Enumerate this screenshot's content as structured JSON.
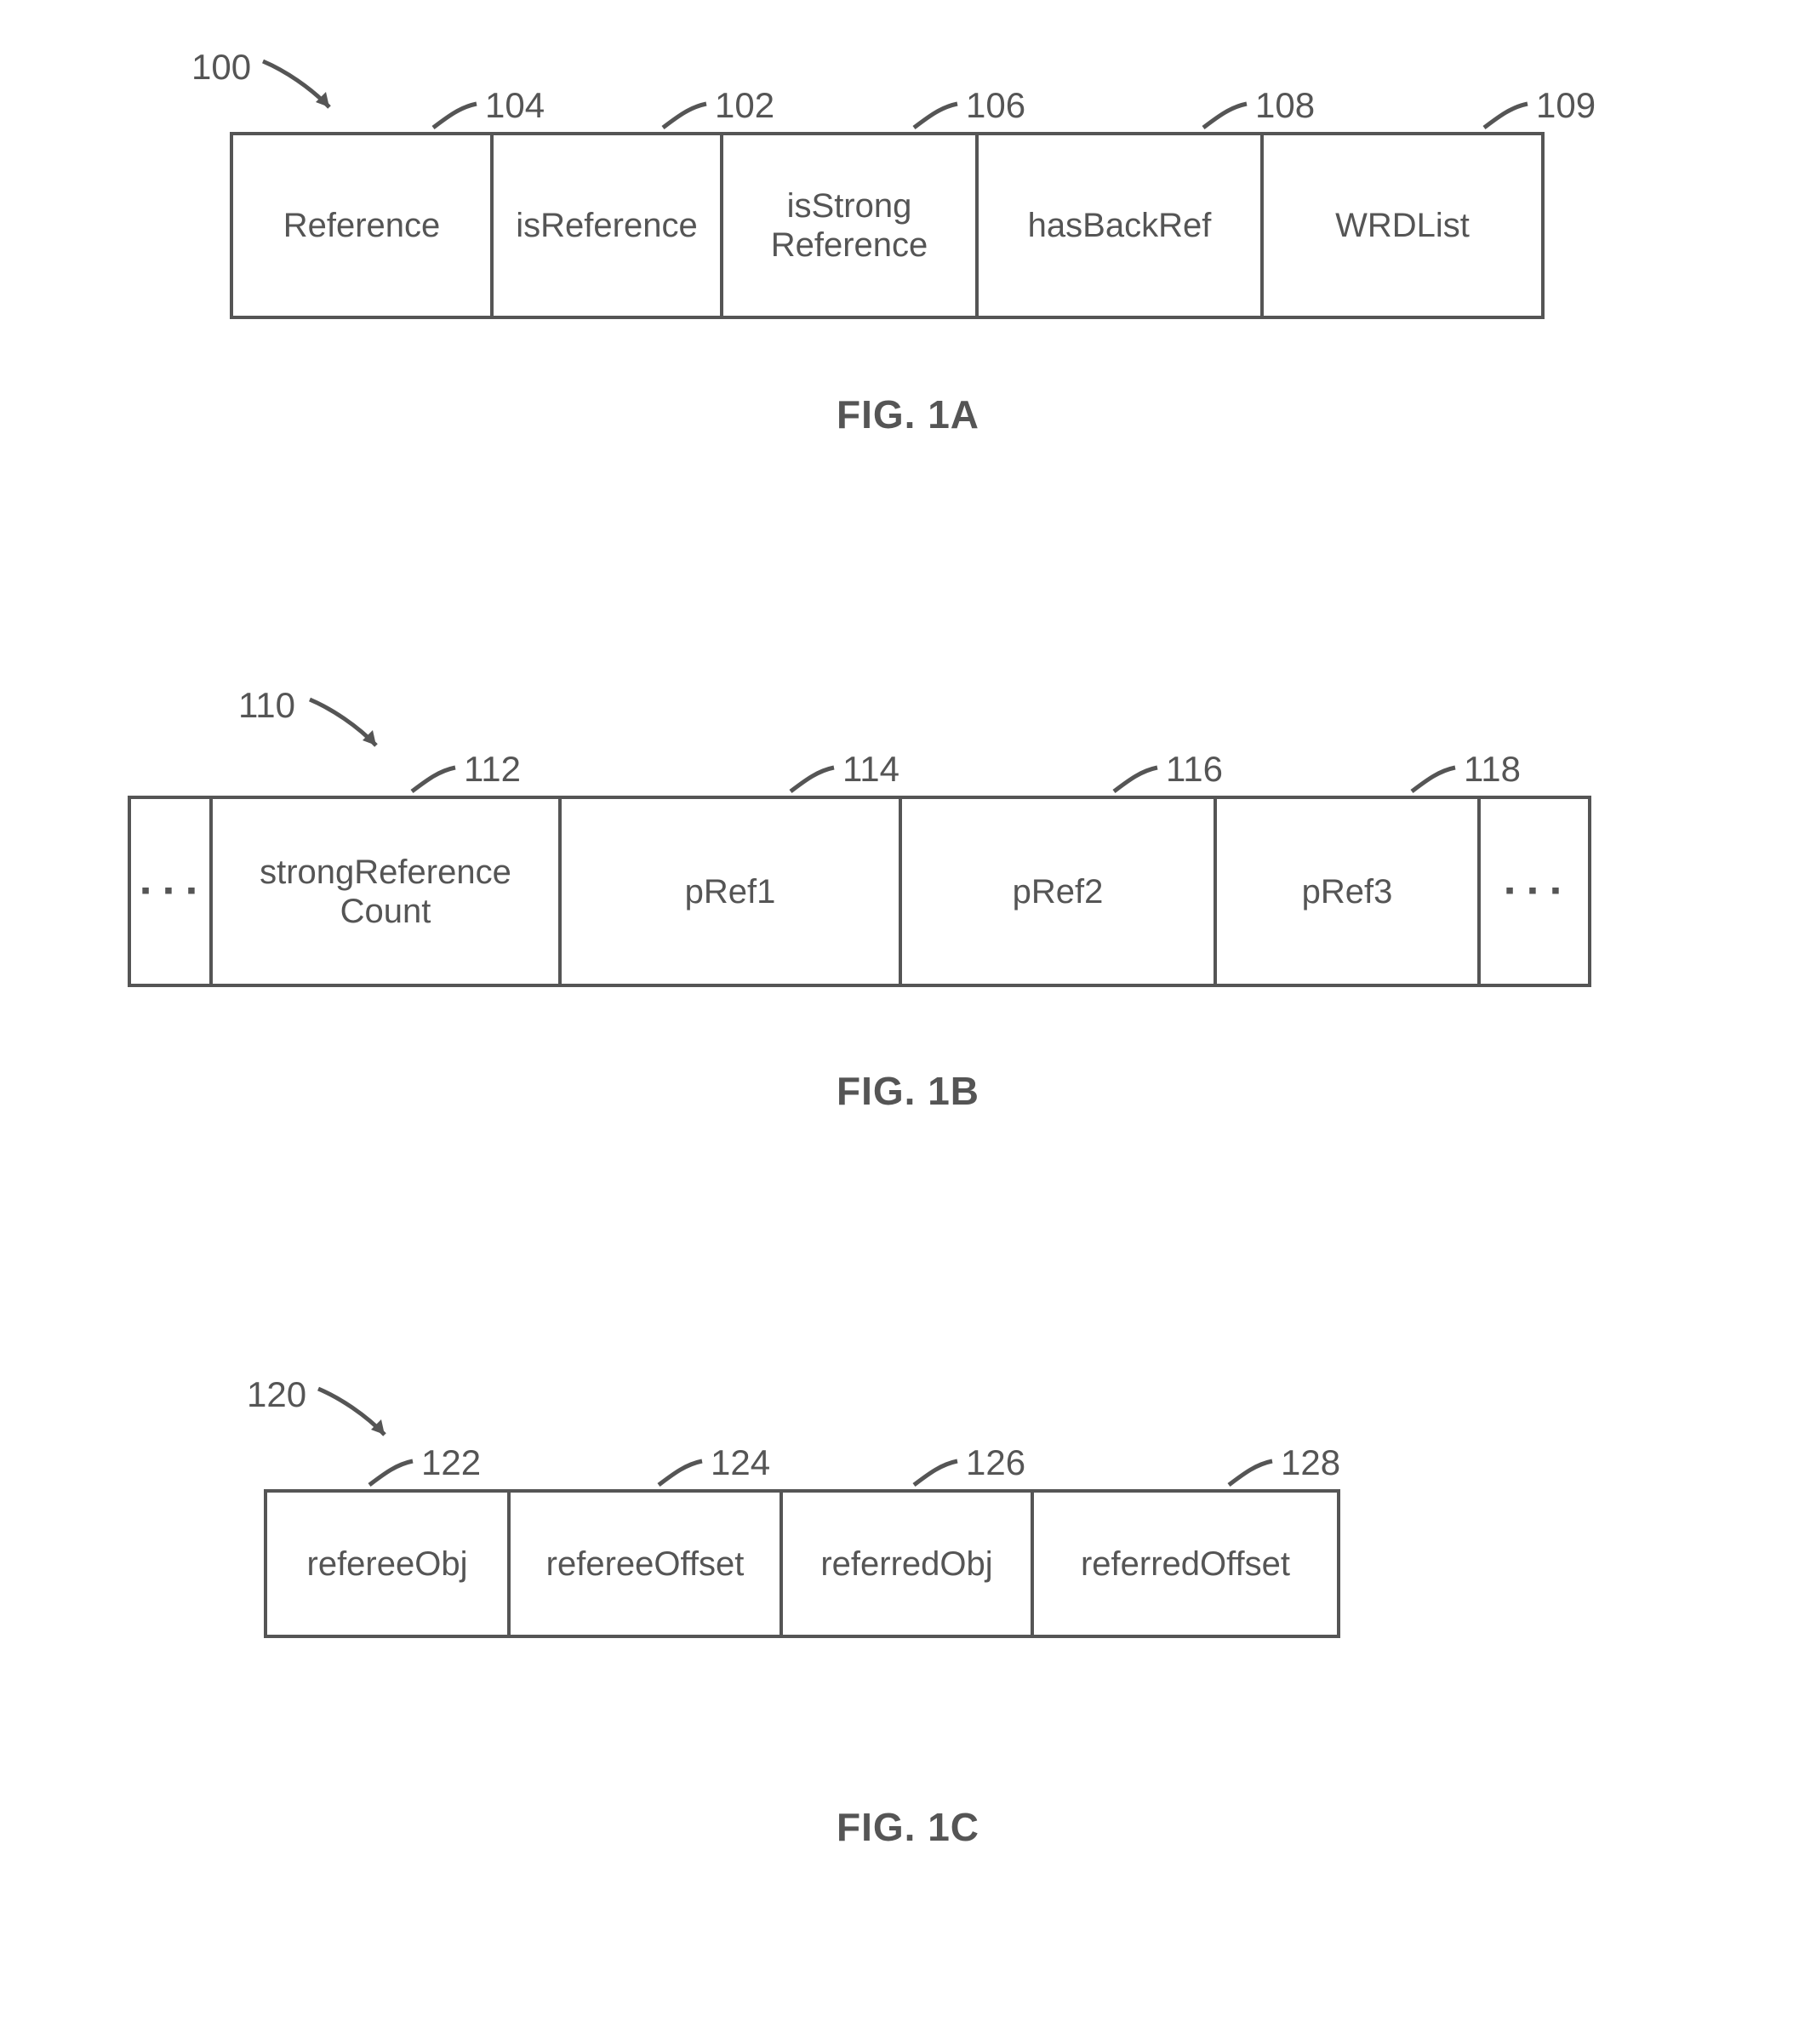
{
  "fig_a": {
    "struct_label": "100",
    "caption": "FIG. 1A",
    "cells": [
      {
        "label": "Reference",
        "num": "104"
      },
      {
        "label": "isReference",
        "num": "102"
      },
      {
        "label": "isStrong\nReference",
        "num": "106"
      },
      {
        "label": "hasBackRef",
        "num": "108"
      },
      {
        "label": "WRDList",
        "num": "109"
      }
    ]
  },
  "fig_b": {
    "struct_label": "110",
    "caption": "FIG. 1B",
    "dots": "▪ ▪ ▪",
    "cells": [
      {
        "label": "strongReference\nCount",
        "num": "112"
      },
      {
        "label": "pRef1",
        "num": "114"
      },
      {
        "label": "pRef2",
        "num": "116"
      },
      {
        "label": "pRef3",
        "num": "118"
      }
    ]
  },
  "fig_c": {
    "struct_label": "120",
    "caption": "FIG. 1C",
    "cells": [
      {
        "label": "refereeObj",
        "num": "122"
      },
      {
        "label": "refereeOffset",
        "num": "124"
      },
      {
        "label": "referredObj",
        "num": "126"
      },
      {
        "label": "referredOffset",
        "num": "128"
      }
    ]
  }
}
